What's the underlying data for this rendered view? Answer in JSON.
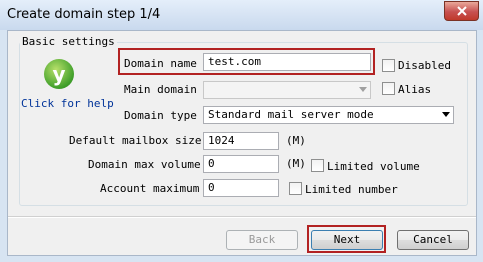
{
  "window": {
    "title": "Create domain step 1/4"
  },
  "settings": {
    "group_title": "Basic settings",
    "help_link": "Click for help",
    "domain_name": {
      "label": "Domain name",
      "value": "test.com"
    },
    "main_domain": {
      "label": "Main domain",
      "value": ""
    },
    "domain_type": {
      "label": "Domain type",
      "value": "Standard mail server mode"
    },
    "default_mailbox_size": {
      "label": "Default mailbox size",
      "value": "1024",
      "unit": "(M)"
    },
    "domain_max_volume": {
      "label": "Domain max volume",
      "value": "0",
      "unit": "(M)"
    },
    "account_maximum": {
      "label": "Account maximum",
      "value": "0"
    },
    "disabled_checkbox": {
      "label": "Disabled",
      "checked": false
    },
    "alias_checkbox": {
      "label": "Alias",
      "checked": false
    },
    "limited_volume_checkbox": {
      "label": "Limited volume",
      "checked": false
    },
    "limited_number_checkbox": {
      "label": "Limited number",
      "checked": false
    }
  },
  "buttons": {
    "back": "Back",
    "next": "Next",
    "cancel": "Cancel"
  },
  "colors": {
    "highlight": "#b22222",
    "link": "#003399",
    "close": "#c75050"
  }
}
